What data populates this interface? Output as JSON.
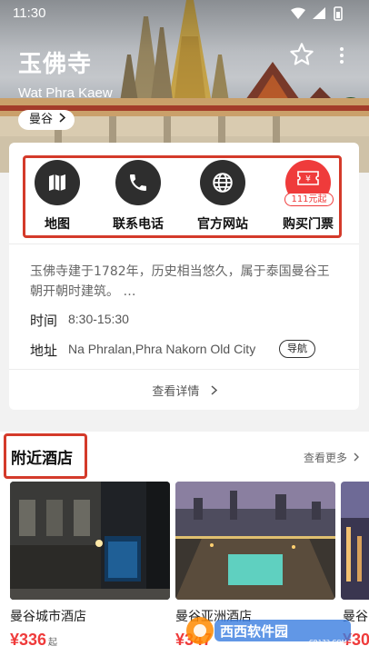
{
  "status_bar": {
    "time": "11:30"
  },
  "attraction": {
    "name_zh": "玉佛寺",
    "name_en": "Wat Phra Kaew",
    "city": "曼谷",
    "description": "玉佛寺建于1782年，历史相当悠久，属于泰国曼谷王朝开朝时建筑。 …",
    "hours_label": "时间",
    "hours": "8:30-15:30",
    "address_label": "地址",
    "address": "Na Phralan,Phra Nakorn Old City",
    "navigate_label": "导航",
    "details_label": "查看详情"
  },
  "actions": [
    {
      "label": "地图",
      "icon": "map-icon"
    },
    {
      "label": "联系电话",
      "icon": "phone-icon"
    },
    {
      "label": "官方网站",
      "icon": "globe-icon"
    },
    {
      "label": "购买门票",
      "icon": "ticket-icon",
      "price_tag": "111元起"
    }
  ],
  "nearby": {
    "title": "附近酒店",
    "see_more": "查看更多",
    "hotels": [
      {
        "name": "曼谷城市酒店",
        "price": "¥336",
        "price_suffix": "起"
      },
      {
        "name": "曼谷亚洲酒店",
        "price": "¥347"
      },
      {
        "name": "曼谷",
        "price": "¥30"
      }
    ]
  },
  "watermark": {
    "text": "西西软件园",
    "sub": "CR173.COM"
  },
  "colors": {
    "accent": "#ef3b3b",
    "highlight_box": "#d43a2a",
    "icon_circle": "#2e2e2e"
  }
}
